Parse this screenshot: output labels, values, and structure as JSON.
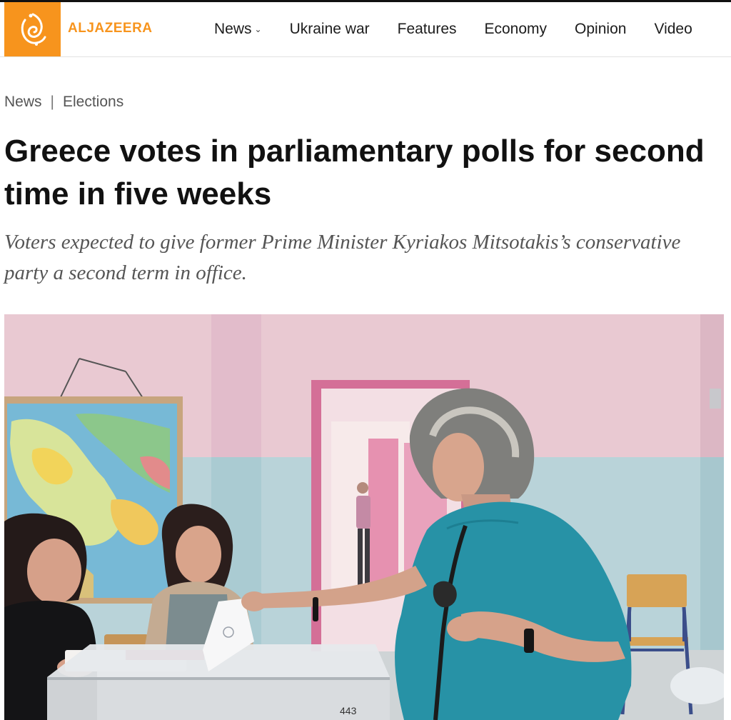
{
  "brand": {
    "name": "ALJAZEERA",
    "accent_color": "#f7941d"
  },
  "nav": {
    "items": [
      {
        "label": "News",
        "has_dropdown": true
      },
      {
        "label": "Ukraine war"
      },
      {
        "label": "Features"
      },
      {
        "label": "Economy"
      },
      {
        "label": "Opinion"
      },
      {
        "label": "Video"
      }
    ]
  },
  "breadcrumb": {
    "section": "News",
    "separator": "|",
    "topic": "Elections"
  },
  "article": {
    "headline": "Greece votes in parliamentary polls for second time in five weeks",
    "subheadline": "Voters expected to give former Prime Minister Kyriakos Mitsotakis’s conservative party a second term in office.",
    "image": {
      "ballot_box_label": "443"
    }
  }
}
